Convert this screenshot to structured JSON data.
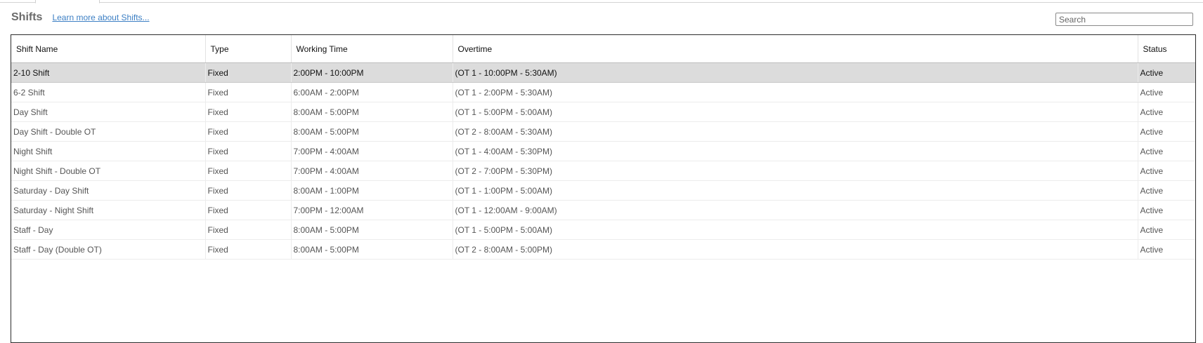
{
  "header": {
    "title": "Shifts",
    "learn_more": "Learn more about Shifts..."
  },
  "search": {
    "placeholder": "Search",
    "value": ""
  },
  "table": {
    "columns": [
      "Shift Name",
      "Type",
      "Working Time",
      "Overtime",
      "Status"
    ],
    "selected_row": 0,
    "rows": [
      [
        "2-10 Shift",
        "Fixed",
        "2:00PM - 10:00PM",
        "(OT 1 - 10:00PM - 5:30AM)",
        "Active"
      ],
      [
        "6-2 Shift",
        "Fixed",
        "6:00AM - 2:00PM",
        "(OT 1 - 2:00PM - 5:30AM)",
        "Active"
      ],
      [
        "Day Shift",
        "Fixed",
        "8:00AM - 5:00PM",
        "(OT 1 - 5:00PM - 5:00AM)",
        "Active"
      ],
      [
        "Day Shift - Double OT",
        "Fixed",
        "8:00AM - 5:00PM",
        "(OT 2 - 8:00AM - 5:30AM)",
        "Active"
      ],
      [
        "Night Shift",
        "Fixed",
        "7:00PM - 4:00AM",
        "(OT 1 - 4:00AM - 5:30PM)",
        "Active"
      ],
      [
        "Night Shift - Double OT",
        "Fixed",
        "7:00PM - 4:00AM",
        "(OT 2 - 7:00PM - 5:30PM)",
        "Active"
      ],
      [
        "Saturday - Day Shift",
        "Fixed",
        "8:00AM - 1:00PM",
        "(OT 1 - 1:00PM - 5:00AM)",
        "Active"
      ],
      [
        "Saturday - Night Shift",
        "Fixed",
        "7:00PM - 12:00AM",
        "(OT 1 - 12:00AM - 9:00AM)",
        "Active"
      ],
      [
        "Staff - Day",
        "Fixed",
        "8:00AM - 5:00PM",
        "(OT 1 - 5:00PM - 5:00AM)",
        "Active"
      ],
      [
        "Staff - Day (Double OT)",
        "Fixed",
        "8:00AM - 5:00PM",
        "(OT 2 - 8:00AM - 5:00PM)",
        "Active"
      ]
    ]
  }
}
